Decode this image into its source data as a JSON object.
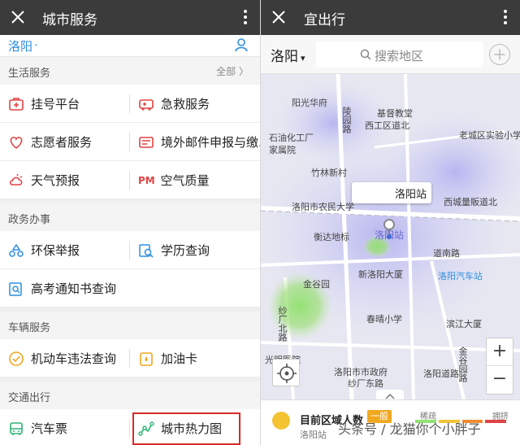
{
  "colors": {
    "topbar": "#3b3b3b",
    "accent": "#2c8fe0",
    "highlight": "#d92a2a",
    "badge": "#f0a81f"
  },
  "left": {
    "title": "城市服务",
    "city": "洛阳",
    "city_caret": "˅",
    "sections": {
      "life": {
        "title": "生活服务",
        "all": "全部 〉"
      },
      "gov": {
        "title": "政务办事"
      },
      "car": {
        "title": "车辆服务"
      },
      "traffic": {
        "title": "交通出行"
      }
    },
    "items": {
      "guahao": "挂号平台",
      "jijiu": "急救服务",
      "zhiyuan": "志愿者服务",
      "jingwai": "境外邮件申报与缴...",
      "tianqi": "天气预报",
      "kongqi_prefix": "PM",
      "kongqi": "空气质量",
      "huanbao": "环保举报",
      "xueli": "学历查询",
      "gaokao": "高考通知书查询",
      "weifa": "机动车违法查询",
      "jiayou": "加油卡",
      "qichepiao": "汽车票",
      "relitu": "城市热力图"
    }
  },
  "right": {
    "title": "宜出行",
    "city": "洛阳",
    "city_caret": "▾",
    "search_placeholder": "搜索地区",
    "map_labels": {
      "yangguang": "阳光华府",
      "linghui": "陵园路",
      "jidu": "基督教堂",
      "xigong": "西工区道北",
      "laocheng": "老城区实验小学",
      "shiyouhua": "石油化工厂",
      "jiashu": "家属院",
      "zhulin": "竹林新村",
      "nongye": "洛阳市农民大学",
      "station": "洛阳站",
      "xicheng": "西城量販道北",
      "hengda": "衡达地标",
      "daonan": "道南路",
      "xinluoyang": "新洛阳大厦",
      "qiche": "洛阳汽车站",
      "jingu": "金谷园",
      "shacha": "纱厂北路",
      "chunqing": "春晴小学",
      "binjiang": "滨江大厦",
      "jingu2": "金谷园路",
      "guangmin": "光明医院",
      "shiyou": "洛阳市市政府",
      "shachang": "纱厂东路",
      "daolu": "洛阳道路"
    },
    "tooltip": "洛阳站",
    "zoom_in": "+",
    "zoom_out": "−",
    "bottom": {
      "count_label": "目前区域人数",
      "level": "一般",
      "station": "洛阳站",
      "legend_low": "稀疏",
      "legend_high": "拥挤"
    },
    "watermark": "头条号 / 龙猫你个小胖子"
  }
}
